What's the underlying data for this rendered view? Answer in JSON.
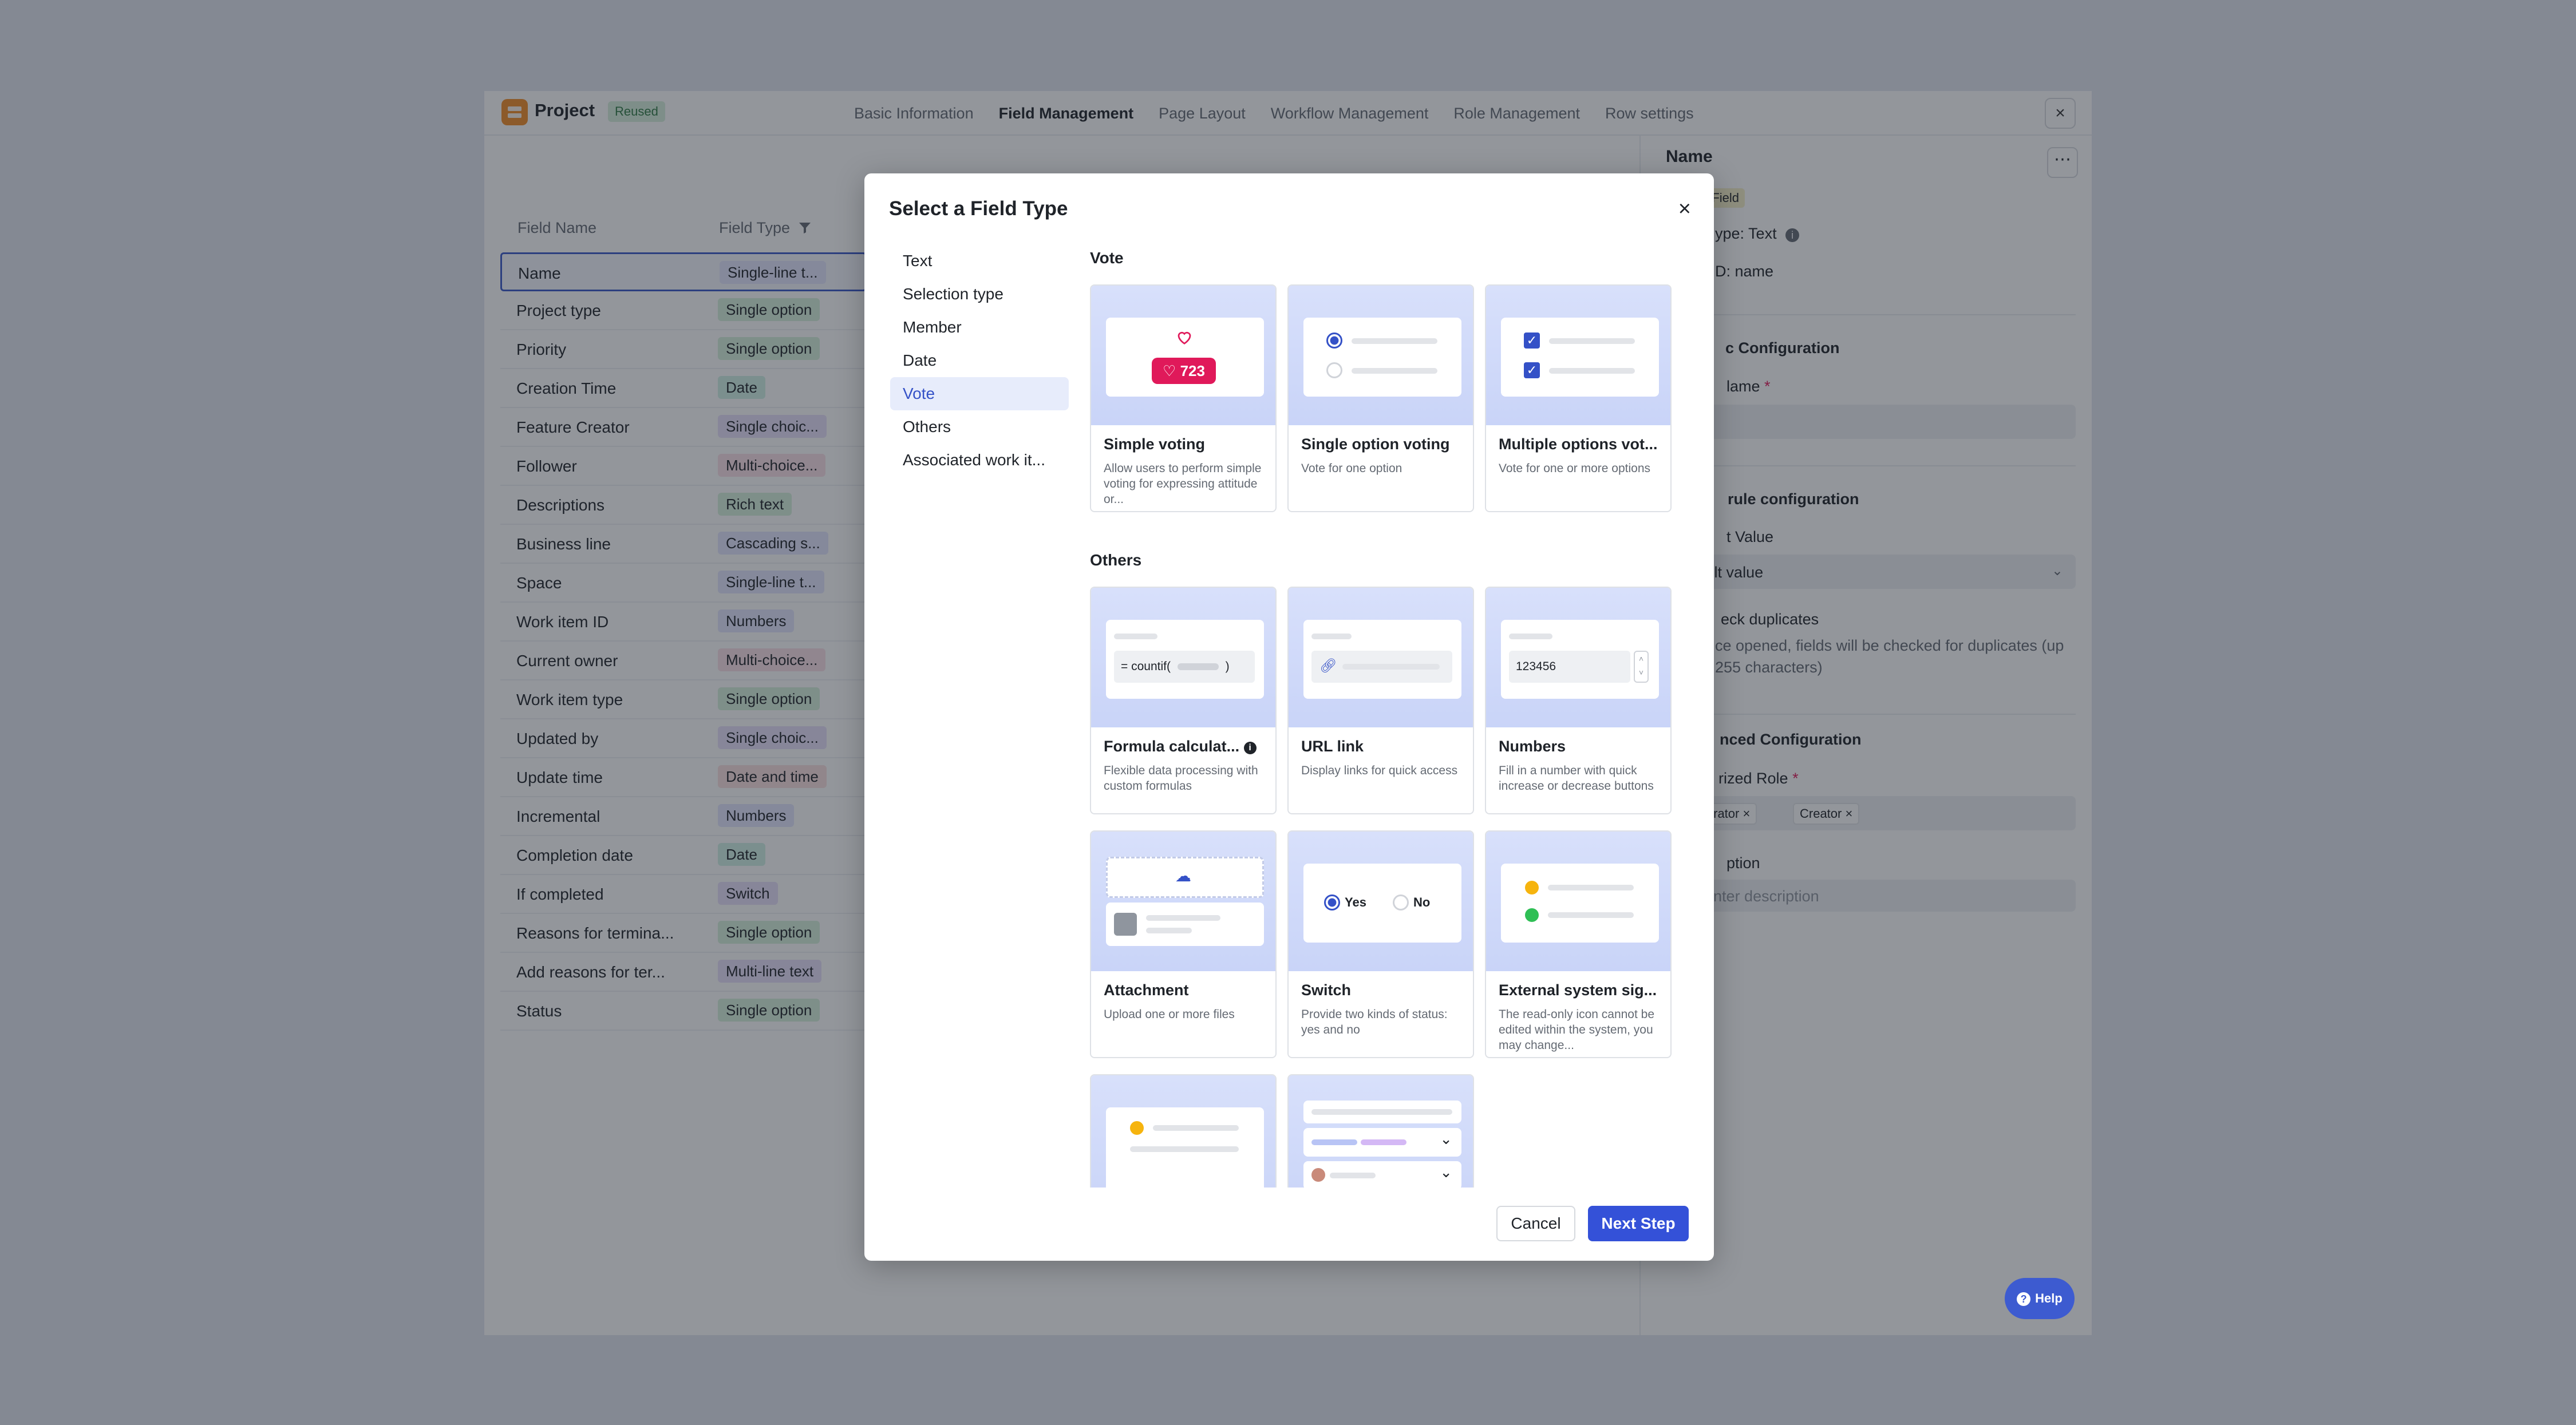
{
  "app": {
    "title": "Project",
    "badge": "Reused"
  },
  "tabs": [
    "Basic Information",
    "Field Management",
    "Page Layout",
    "Workflow Management",
    "Role Management",
    "Row settings"
  ],
  "window": {
    "close_icon": "×"
  },
  "field_table": {
    "headers": {
      "name": "Field Name",
      "type": "Field Type"
    },
    "rows": [
      {
        "name": "Name",
        "type": "Single-line t...",
        "color": "#e5e7ff"
      },
      {
        "name": "Project type",
        "type": "Single option",
        "color": "#d7f1dc"
      },
      {
        "name": "Priority",
        "type": "Single option",
        "color": "#d7f1dc"
      },
      {
        "name": "Creation Time",
        "type": "Date",
        "color": "#d2f1e7"
      },
      {
        "name": "Feature Creator",
        "type": "Single choic...",
        "color": "#e8e0fb"
      },
      {
        "name": "Follower",
        "type": "Multi-choice...",
        "color": "#fbe1e8"
      },
      {
        "name": "Descriptions",
        "type": "Rich text",
        "color": "#d7f1dc"
      },
      {
        "name": "Business line",
        "type": "Cascading s...",
        "color": "#e5e7ff"
      },
      {
        "name": "Space",
        "type": "Single-line t...",
        "color": "#e5e7ff"
      },
      {
        "name": "Work item ID",
        "type": "Numbers",
        "color": "#e5e7ff"
      },
      {
        "name": "Current owner",
        "type": "Multi-choice...",
        "color": "#fbe1e8"
      },
      {
        "name": "Work item type",
        "type": "Single option",
        "color": "#d7f1dc"
      },
      {
        "name": "Updated by",
        "type": "Single choic...",
        "color": "#e8e0fb"
      },
      {
        "name": "Update time",
        "type": "Date and time",
        "color": "#fbe1e1"
      },
      {
        "name": "Incremental",
        "type": "Numbers",
        "color": "#e5e7ff"
      },
      {
        "name": "Completion date",
        "type": "Date",
        "color": "#d2f1e7"
      },
      {
        "name": "If completed",
        "type": "Switch",
        "color": "#e8e0fb"
      },
      {
        "name": "Reasons for termina...",
        "type": "Single option",
        "color": "#d7f1dc"
      },
      {
        "name": "Add reasons for ter...",
        "type": "Multi-line text",
        "color": "#e8e0fb"
      },
      {
        "name": "Status",
        "type": "Single option",
        "color": "#d7f1dc"
      }
    ]
  },
  "right_panel": {
    "title": "Name",
    "field_badge": "n Field",
    "type_line": "ype:  Text",
    "id_line": "D:  name",
    "basic_config": "c Configuration",
    "name_label": "lame",
    "name_value": "e",
    "rule_config": "rule configuration",
    "default_label": "t Value",
    "default_value": "efault value",
    "check_dup": "eck duplicates",
    "check_dup_desc1": "ce opened, fields will be checked for duplicates (up",
    "check_dup_desc2": "255 characters)",
    "advanced": "nced Configuration",
    "role_label": "rized Role",
    "role_tag1": "inistrator",
    "role_tag2": "Creator",
    "desc_label": "ption",
    "desc_placeholder": "se enter description"
  },
  "help": {
    "label": "Help"
  },
  "modal": {
    "title": "Select a Field Type",
    "close_icon": "×",
    "categories": [
      "Text",
      "Selection type",
      "Member",
      "Date",
      "Vote",
      "Others",
      "Associated work it..."
    ],
    "active_category": "Vote",
    "sections": {
      "vote": "Vote",
      "others": "Others"
    },
    "cards": {
      "simple_voting": {
        "name": "Simple voting",
        "desc": "Allow users to perform simple voting for expressing attitude or...",
        "count": "723"
      },
      "single_option_voting": {
        "name": "Single option voting",
        "desc": "Vote for one option"
      },
      "multiple_options_voting": {
        "name": "Multiple options vot...",
        "desc": "Vote for one or more options"
      },
      "formula": {
        "name": "Formula calculat...",
        "desc": "Flexible data processing with custom formulas",
        "snippet_open": "= countif(",
        "snippet_close": ")"
      },
      "url_link": {
        "name": "URL link",
        "desc": "Display links for quick access"
      },
      "numbers": {
        "name": "Numbers",
        "desc": "Fill in a number with quick increase or decrease buttons",
        "value": "123456"
      },
      "attachment": {
        "name": "Attachment",
        "desc": "Upload one or more files"
      },
      "switch": {
        "name": "Switch",
        "desc": "Provide two kinds of status: yes and no",
        "yes": "Yes",
        "no": "No"
      },
      "external_signal": {
        "name": "External system sig...",
        "desc": "The read-only icon cannot be edited within the system, you may change..."
      }
    },
    "buttons": {
      "cancel": "Cancel",
      "next": "Next Step"
    }
  },
  "colors": {
    "accent": "#3451d8",
    "vote_pink": "#e0195a"
  }
}
